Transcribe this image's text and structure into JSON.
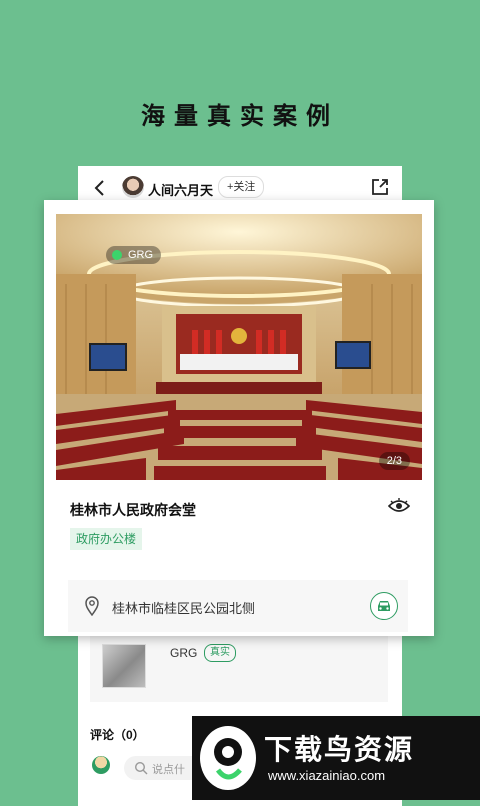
{
  "promo": {
    "title": "海量真实案例"
  },
  "header": {
    "username": "人间六月天",
    "follow_label": "+关注"
  },
  "project": {
    "brand": "GRG",
    "image_index": "2/3",
    "title": "桂林市人民政府会堂",
    "tag": "政府办公楼",
    "address": "桂林市临桂区民公园北侧"
  },
  "related": {
    "name": "GRG",
    "badge": "真实"
  },
  "comments": {
    "title": "评论（0）",
    "placeholder": "说点什"
  },
  "watermark": {
    "title": "下载鸟资源",
    "url": "www.xiazainiao.com"
  },
  "colors": {
    "background": "#6cbf8f",
    "accent": "#2e9c62"
  },
  "icons": [
    "back-icon",
    "share-icon",
    "eye-icon",
    "location-icon",
    "car-icon",
    "search-icon"
  ]
}
